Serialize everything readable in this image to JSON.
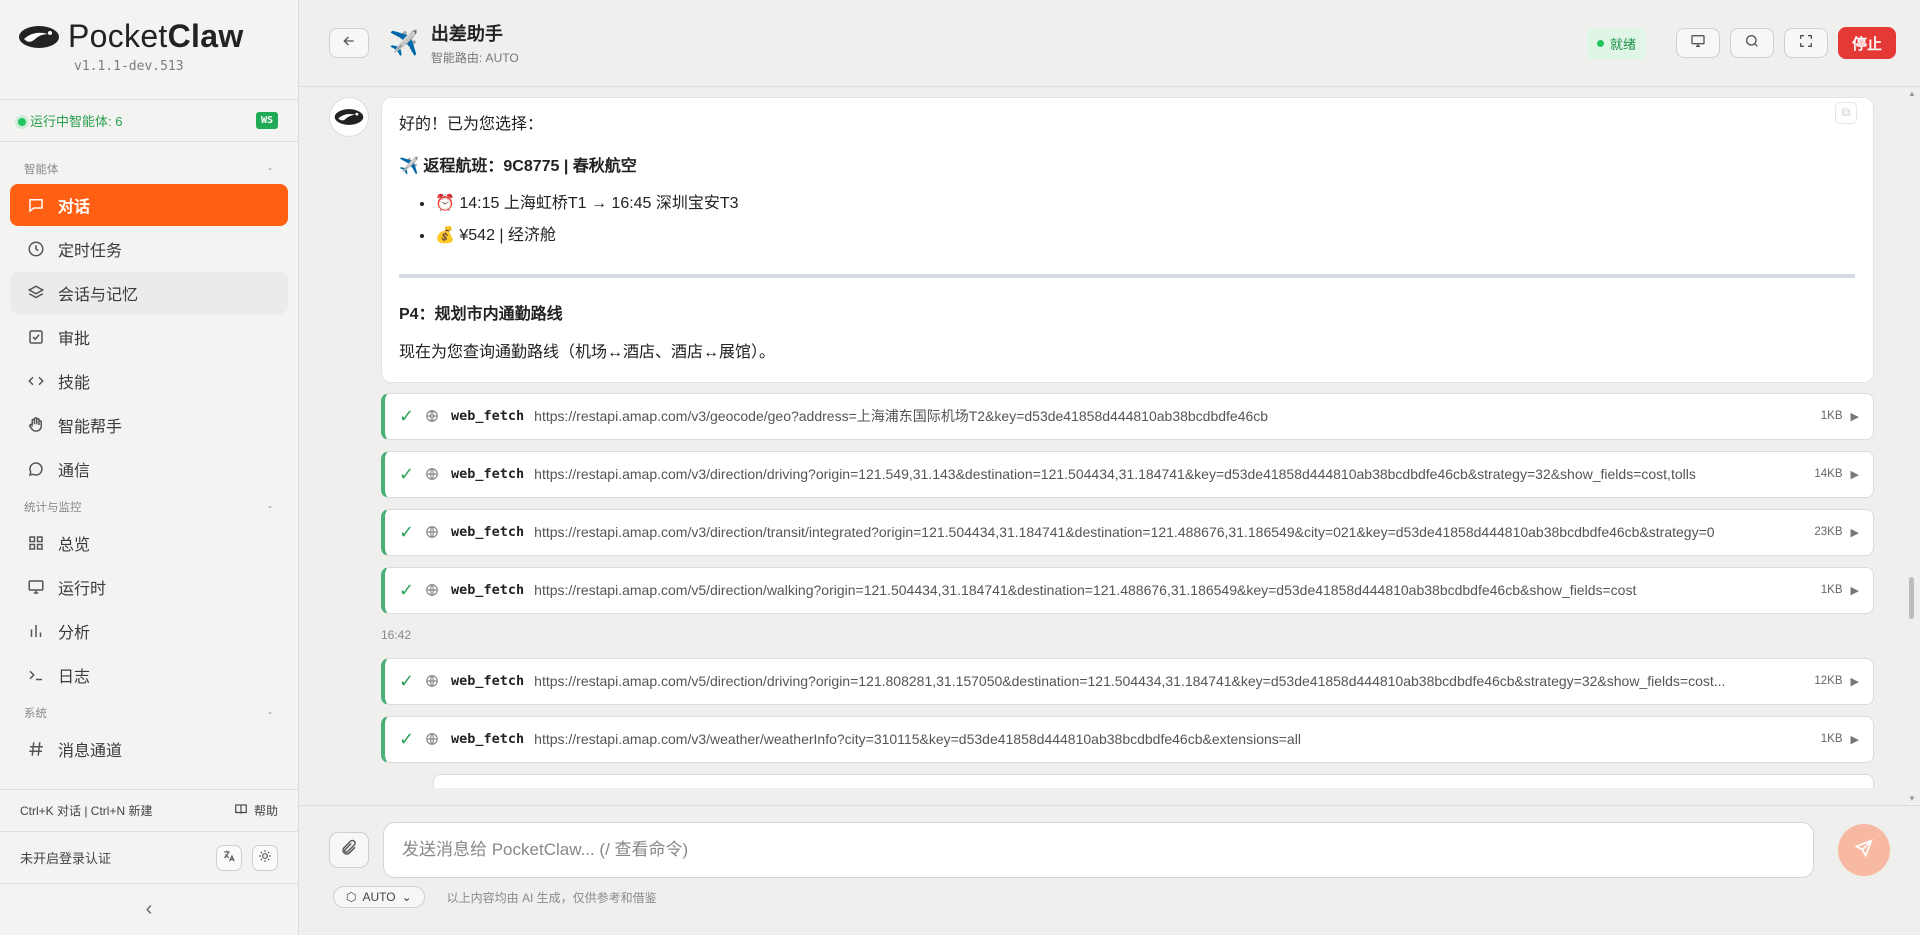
{
  "sidebar": {
    "brand_light": "Pocket",
    "brand_bold": "Claw",
    "version": "v1.1.1-dev.513",
    "running_label": "运行中智能体: 6",
    "ws_badge": "WS",
    "sections": [
      {
        "title": "智能体",
        "collapse": "-"
      },
      {
        "title": "统计与监控",
        "collapse": "-"
      },
      {
        "title": "系统",
        "collapse": "-"
      }
    ],
    "items": [
      {
        "label": "对话",
        "icon": "chat-icon"
      },
      {
        "label": "定时任务",
        "icon": "clock-icon"
      },
      {
        "label": "会话与记忆",
        "icon": "layers-icon"
      },
      {
        "label": "审批",
        "icon": "checkbox-icon"
      },
      {
        "label": "技能",
        "icon": "code-icon"
      },
      {
        "label": "智能帮手",
        "icon": "hand-icon"
      },
      {
        "label": "通信",
        "icon": "message-icon"
      },
      {
        "label": "总览",
        "icon": "grid-icon"
      },
      {
        "label": "运行时",
        "icon": "monitor-icon"
      },
      {
        "label": "分析",
        "icon": "bar-chart-icon"
      },
      {
        "label": "日志",
        "icon": "terminal-icon"
      },
      {
        "label": "消息通道",
        "icon": "hash-icon"
      }
    ],
    "shortcut_hint": "Ctrl+K 对话 | Ctrl+N 新建",
    "help_label": "帮助",
    "auth_status": "未开启登录认证",
    "collapse_glyph": "‹"
  },
  "header": {
    "agent_name": "出差助手",
    "routing": "智能路由: AUTO",
    "status_label": "就绪",
    "stop_label": "停止"
  },
  "message": {
    "intro": "好的！已为您选择：",
    "flight_heading": "✈️ 返程航班：9C8775 | 春秋航空",
    "bullets": [
      "⏰ 14:15 上海虹桥T1 → 16:45 深圳宝安T3",
      "💰 ¥542 | 经济舱"
    ],
    "section_heading": "P4：规划市内通勤路线",
    "section_text": "现在为您查询通勤路线（机场↔酒店、酒店↔展馆）。"
  },
  "tool_calls_a": [
    {
      "name": "web_fetch",
      "url": "https://restapi.amap.com/v3/geocode/geo?address=上海浦东国际机场T2&key=d53de41858d444810ab38bcdbdfe46cb",
      "size": "1KB"
    },
    {
      "name": "web_fetch",
      "url": "https://restapi.amap.com/v3/direction/driving?origin=121.549,31.143&destination=121.504434,31.184741&key=d53de41858d444810ab38bcdbdfe46cb&strategy=32&show_fields=cost,tolls",
      "size": "14KB"
    },
    {
      "name": "web_fetch",
      "url": "https://restapi.amap.com/v3/direction/transit/integrated?origin=121.504434,31.184741&destination=121.488676,31.186549&city=021&key=d53de41858d444810ab38bcdbdfe46cb&strategy=0",
      "size": "23KB"
    },
    {
      "name": "web_fetch",
      "url": "https://restapi.amap.com/v5/direction/walking?origin=121.504434,31.184741&destination=121.488676,31.186549&key=d53de41858d444810ab38bcdbdfe46cb&show_fields=cost",
      "size": "1KB"
    }
  ],
  "timestamp": "16:42",
  "tool_calls_b": [
    {
      "name": "web_fetch",
      "url": "https://restapi.amap.com/v5/direction/driving?origin=121.808281,31.157050&destination=121.504434,31.184741&key=d53de41858d444810ab38bcdbdfe46cb&strategy=32&show_fields=cost...",
      "size": "12KB"
    },
    {
      "name": "web_fetch",
      "url": "https://restapi.amap.com/v3/weather/weatherInfo?city=310115&key=d53de41858d444810ab38bcdbdfe46cb&extensions=all",
      "size": "1KB"
    }
  ],
  "composer": {
    "placeholder": "发送消息给 PocketClaw... (/ 查看命令)",
    "mode_label": "AUTO",
    "disclaimer": "以上内容均由 AI 生成，仅供参考和借鉴"
  },
  "colors": {
    "accent": "#ff6014",
    "success": "#22c55e",
    "danger": "#e53935",
    "send_disabled": "#f7b9a2"
  }
}
